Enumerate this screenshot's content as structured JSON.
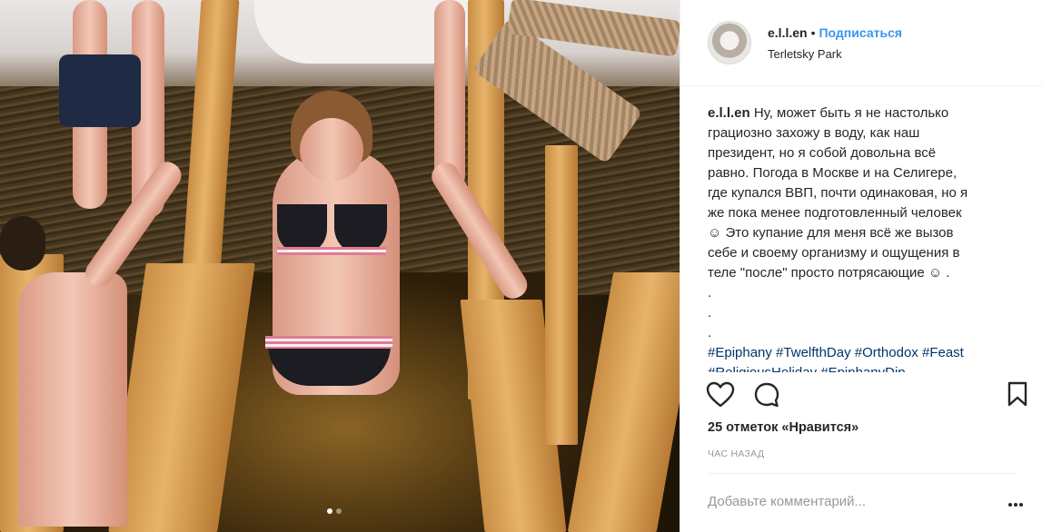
{
  "post": {
    "username": "e.l.l.en",
    "separator": "•",
    "follow_label": "Подписаться",
    "location": "Terletsky Park",
    "caption_lines": [
      "Ну, может быть я не настолько",
      "грациозно захожу в воду, как наш",
      "президент, но я собой довольна всё",
      "равно. Погода в Москве и на Селигере,",
      "где купался ВВП, почти одинаковая, но я",
      "же пока менее подготовленный человек",
      "☺ Это купание для меня всё же вызов",
      "себе и своему организму и ощущения в",
      "теле \"после\" просто потрясающие ☺ .",
      ".",
      ".",
      "."
    ],
    "hashtags_line1": "#Epiphany #TwelfthDay #Orthodox #Feast",
    "hashtags_line2": "#ReligiousHoliday #EpiphanyDip",
    "likes": "25 отметок «Нравится»",
    "time": "час назад",
    "comment_placeholder": "Добавьте комментарий...",
    "carousel": {
      "total": 2,
      "active": 1
    }
  },
  "icons": {
    "like": "heart-icon",
    "comment": "comment-icon",
    "save": "bookmark-icon",
    "more": "more-options-icon"
  },
  "colors": {
    "link": "#3897f0",
    "hashtag": "#003569",
    "muted": "#999999",
    "text": "#262626"
  }
}
